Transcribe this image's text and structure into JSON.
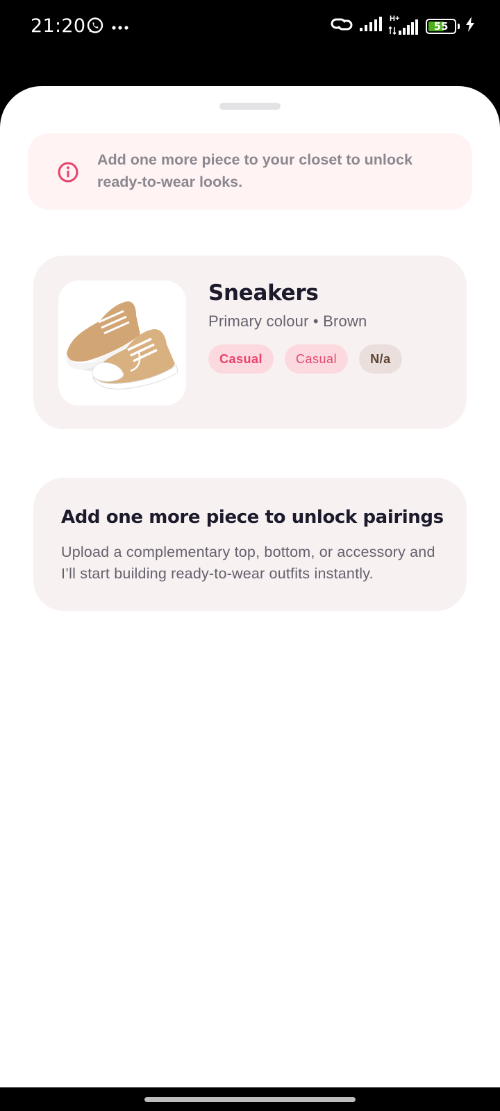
{
  "status_bar": {
    "time": "21:20",
    "battery_level": "55",
    "battery_fraction": 0.55,
    "icons": [
      "whatsapp-icon",
      "more-dots-icon",
      "link-icon",
      "signal-icon",
      "hplus-signal-icon",
      "battery-icon",
      "charging-bolt-icon"
    ],
    "network_label": "H+"
  },
  "banner": {
    "icon": "info-icon",
    "text": "Add one more piece to your closet to unlock ready-to-wear looks.",
    "accent_color": "#e8426b"
  },
  "item": {
    "title": "Sneakers",
    "subtitle": "Primary colour • Brown",
    "tags": [
      "Casual",
      "Casual",
      "N/a"
    ]
  },
  "unlock": {
    "title": "Add one more piece to unlock pairings",
    "body": "Upload a complementary top, bottom, or accessory and I’ll start building ready-to-wear outfits instantly."
  }
}
